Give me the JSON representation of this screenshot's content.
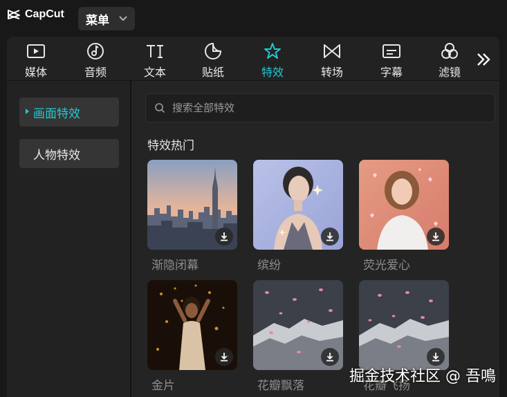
{
  "app": {
    "name": "CapCut",
    "menu_label": "菜单"
  },
  "tabs": [
    {
      "label": "媒体",
      "icon": "media-icon"
    },
    {
      "label": "音频",
      "icon": "audio-icon"
    },
    {
      "label": "文本",
      "icon": "text-icon"
    },
    {
      "label": "贴纸",
      "icon": "sticker-icon"
    },
    {
      "label": "特效",
      "icon": "effects-icon",
      "active": true
    },
    {
      "label": "转场",
      "icon": "transition-icon"
    },
    {
      "label": "字幕",
      "icon": "caption-icon"
    },
    {
      "label": "滤镜",
      "icon": "filter-icon"
    }
  ],
  "sidebar": {
    "items": [
      {
        "label": "画面特效",
        "active": true
      },
      {
        "label": "人物特效",
        "active": false
      }
    ]
  },
  "search": {
    "placeholder": "搜索全部特效",
    "value": ""
  },
  "section": {
    "title": "特效热门"
  },
  "effects": [
    {
      "name": "渐隐闭幕"
    },
    {
      "name": "缤纷"
    },
    {
      "name": "荧光爱心"
    },
    {
      "name": "金片"
    },
    {
      "name": "花瓣飘落"
    },
    {
      "name": "花瓣飞扬"
    }
  ],
  "watermark": "掘金技术社区 @ 吾鳴",
  "colors": {
    "accent": "#22c8d0",
    "background": "#181818",
    "panel": "#242424"
  }
}
